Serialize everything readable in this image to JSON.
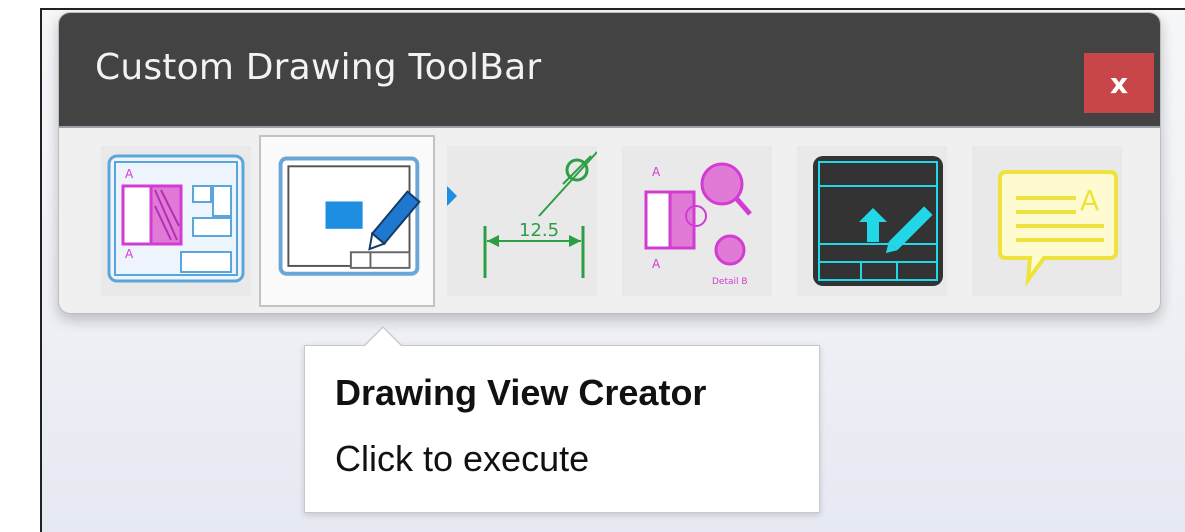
{
  "toolbar": {
    "title": "Custom Drawing ToolBar",
    "close_label": "x",
    "tools": [
      {
        "name": "Drawing Layout",
        "icon": "drawing-layout-icon"
      },
      {
        "name": "Drawing View Creator",
        "icon": "drawing-view-creator-icon",
        "selected": true
      },
      {
        "name": "Dimension",
        "icon": "dimension-icon",
        "dimension_text": "12.5"
      },
      {
        "name": "Section and Detail Views",
        "icon": "section-detail-icon",
        "detail_text": "Detail B"
      },
      {
        "name": "Title Block Editor",
        "icon": "title-block-editor-icon"
      },
      {
        "name": "Annotation Note",
        "icon": "annotation-note-icon"
      }
    ]
  },
  "tooltip": {
    "title": "Drawing View Creator",
    "subtitle": "Click to execute"
  },
  "colors": {
    "titlebar": "#434343",
    "close": "#c8464a",
    "magenta": "#d23cd2",
    "blue": "#1e8fe0",
    "green": "#2e9e44",
    "yellow": "#f0e23c",
    "cyan": "#22d8e8"
  }
}
